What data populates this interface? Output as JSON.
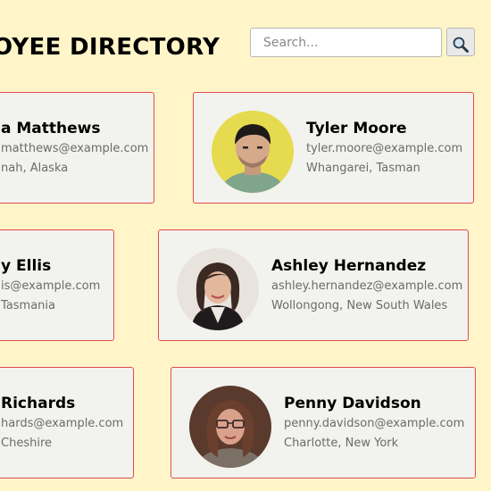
{
  "header": {
    "title": "LOYEE DIRECTORY",
    "search_placeholder": "Search..."
  },
  "icons": {
    "search": "magnifier-icon"
  },
  "colors": {
    "page_background": "#FFF5C8",
    "card_background": "#F2F2EE",
    "card_border": "#E24B55"
  },
  "employees": [
    {
      "name": "a Matthews",
      "email": "matthews@example.com",
      "location": "nah, Alaska"
    },
    {
      "name": "Tyler Moore",
      "email": "tyler.moore@example.com",
      "location": "Whangarei, Tasman"
    },
    {
      "name": "y Ellis",
      "email": "is@example.com",
      "location": "Tasmania"
    },
    {
      "name": "Ashley Hernandez",
      "email": "ashley.hernandez@example.com",
      "location": "Wollongong, New South Wales"
    },
    {
      "name": "Richards",
      "email": "hards@example.com",
      "location": "Cheshire"
    },
    {
      "name": "Penny Davidson",
      "email": "penny.davidson@example.com",
      "location": "Charlotte, New York"
    }
  ]
}
